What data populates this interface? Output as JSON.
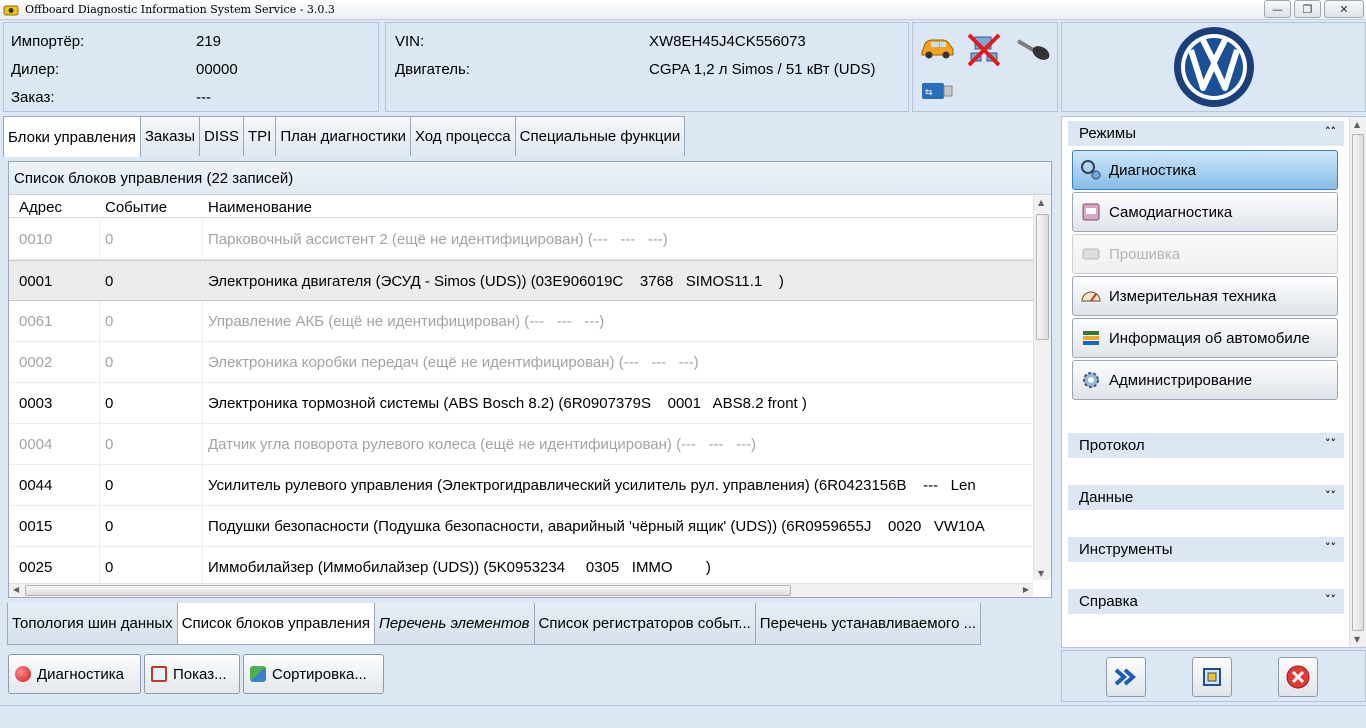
{
  "window": {
    "title": "Offboard Diagnostic Information System Service - 3.0.3",
    "buttons": {
      "minimize": "—",
      "maximize": "❐",
      "close": "✕"
    }
  },
  "header": {
    "importer_label": "Импортёр:",
    "importer_value": "219",
    "dealer_label": "Дилер:",
    "dealer_value": "00000",
    "order_label": "Заказ:",
    "order_value": "---",
    "vin_label": "VIN:",
    "vin_value": "XW8EH45J4CK556073",
    "engine_label": "Двигатель:",
    "engine_value": "CGPA 1,2 л Simos / 51 кВт (UDS)",
    "status_icons": [
      "car-icon",
      "network-disconnected-icon",
      "key-icon",
      "usb-icon"
    ],
    "logo": "volkswagen-logo"
  },
  "top_tabs": [
    "Блоки управления",
    "Заказы",
    "DISS",
    "TPI",
    "План диагностики",
    "Ход процесса",
    "Специальные функции"
  ],
  "list": {
    "caption": "Список блоков управления (22 записей)",
    "columns": [
      "Адрес",
      "Событие",
      "Наименование"
    ],
    "rows": [
      {
        "address": "0010",
        "event": "0",
        "name": "Парковочный ассистент 2 (ещё не идентифицирован) (---   ---   ---)",
        "status": "inactive"
      },
      {
        "address": "0001",
        "event": "0",
        "name": "Электроника двигателя (ЭСУД - Simos (UDS)) (03E906019C    3768   SIMOS11.1    )",
        "status": "selected"
      },
      {
        "address": "0061",
        "event": "0",
        "name": "Управление АКБ (ещё не идентифицирован) (---   ---   ---)",
        "status": "inactive"
      },
      {
        "address": "0002",
        "event": "0",
        "name": "Электроника коробки передач (ещё не идентифицирован) (---   ---   ---)",
        "status": "inactive"
      },
      {
        "address": "0003",
        "event": "0",
        "name": "Электроника тормозной системы (ABS Bosch 8.2) (6R0907379S    0001   ABS8.2 front )",
        "status": "active"
      },
      {
        "address": "0004",
        "event": "0",
        "name": "Датчик угла поворота рулевого колеса (ещё не идентифицирован) (---   ---   ---)",
        "status": "inactive"
      },
      {
        "address": "0044",
        "event": "0",
        "name": "Усилитель рулевого управления (Электрогидравлический усилитель рул. управления) (6R0423156B    ---   Len",
        "status": "active"
      },
      {
        "address": "0015",
        "event": "0",
        "name": "Подушки безопасности (Подушка безопасности, аварийный 'чёрный ящик' (UDS)) (6R0959655J    0020   VW10A",
        "status": "active"
      },
      {
        "address": "0025",
        "event": "0",
        "name": "Иммобилайзер (Иммобилайзер (UDS)) (5K0953234     0305   IMMO        )",
        "status": "active"
      }
    ]
  },
  "bottom_tabs": [
    "Топология шин данных",
    "Список блоков управления",
    "Перечень элементов",
    "Список регистраторов событ...",
    "Перечень устанавливаемого ..."
  ],
  "actions": {
    "diagnostics": "Диагностика",
    "show": "Показ...",
    "sort": "Сортировка..."
  },
  "right_panel": {
    "modes_title": "Режимы",
    "modes": [
      "Диагностика",
      "Самодиагностика",
      "Прошивка",
      "Измерительная техника",
      "Информация об автомобиле",
      "Администрирование"
    ],
    "sections": [
      "Протокол",
      "Данные",
      "Инструменты",
      "Справка"
    ],
    "chevron_up": "˄˄",
    "chevron_down": "˅˅"
  },
  "colors": {
    "accent_blue": "#86bde8",
    "inactive_text": "#a3a3a3",
    "panel_bg": "#dce7f4"
  }
}
